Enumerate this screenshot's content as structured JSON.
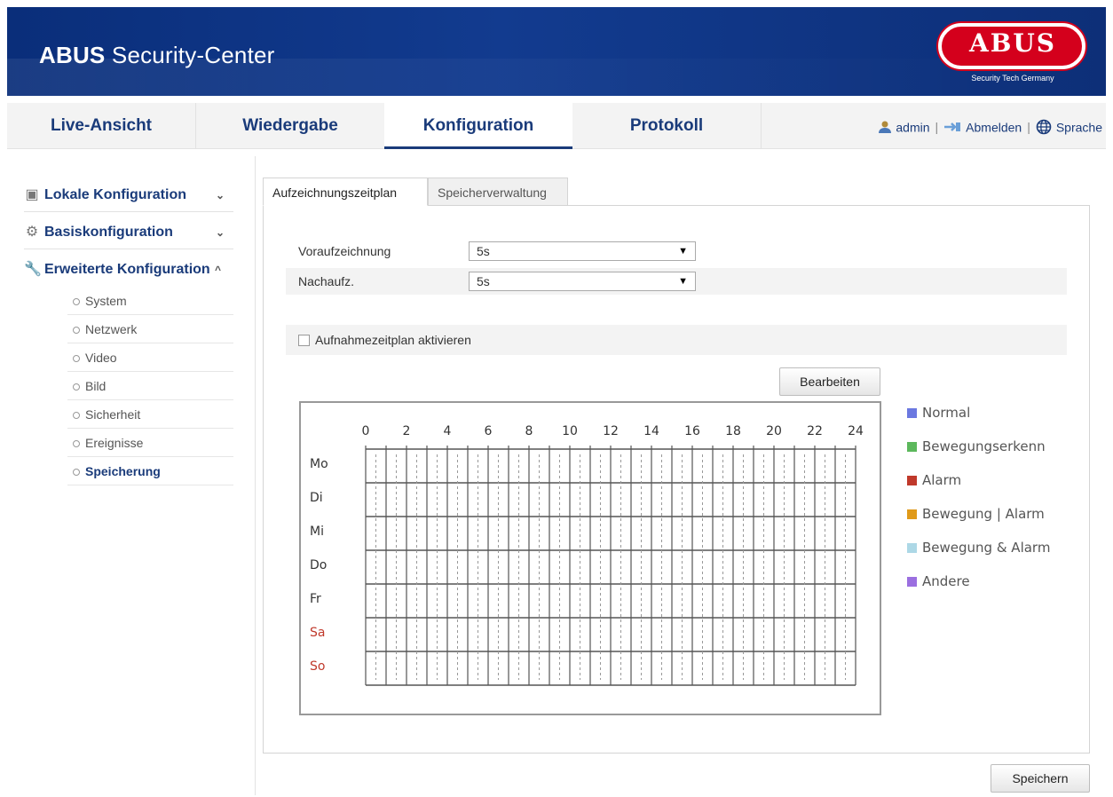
{
  "header": {
    "title_bold": "ABUS",
    "title_rest": " Security-Center",
    "logo_text": "ABUS",
    "logo_sub": "Security Tech Germany"
  },
  "nav": {
    "tabs": [
      {
        "label": "Live-Ansicht"
      },
      {
        "label": "Wiedergabe"
      },
      {
        "label": "Konfiguration",
        "active": true
      },
      {
        "label": "Protokoll"
      }
    ],
    "user": "admin",
    "logout": "Abmelden",
    "language": "Sprache"
  },
  "sidebar": {
    "groups": [
      {
        "label": "Lokale Konfiguration",
        "icon": "monitor-icon",
        "expanded": false
      },
      {
        "label": "Basiskonfiguration",
        "icon": "gear-icon",
        "expanded": false
      },
      {
        "label": "Erweiterte Konfiguration",
        "icon": "wrench-icon",
        "expanded": true
      }
    ],
    "items": [
      {
        "label": "System"
      },
      {
        "label": "Netzwerk"
      },
      {
        "label": "Video"
      },
      {
        "label": "Bild"
      },
      {
        "label": "Sicherheit"
      },
      {
        "label": "Ereignisse"
      },
      {
        "label": "Speicherung",
        "active": true
      }
    ]
  },
  "content": {
    "tabs": [
      {
        "label": "Aufzeichnungszeitplan",
        "active": true
      },
      {
        "label": "Speicherverwaltung"
      }
    ],
    "pre_record": {
      "label": "Voraufzeichnung",
      "value": "5s"
    },
    "post_record": {
      "label": "Nachaufz.",
      "value": "5s"
    },
    "enable_schedule": {
      "label": "Aufnahmezeitplan aktivieren",
      "checked": false
    },
    "edit_button": "Bearbeiten",
    "save_button": "Speichern"
  },
  "schedule": {
    "hours": [
      "0",
      "2",
      "4",
      "6",
      "8",
      "10",
      "12",
      "14",
      "16",
      "18",
      "20",
      "22",
      "24"
    ],
    "days": [
      {
        "label": "Mo",
        "weekend": false
      },
      {
        "label": "Di",
        "weekend": false
      },
      {
        "label": "Mi",
        "weekend": false
      },
      {
        "label": "Do",
        "weekend": false
      },
      {
        "label": "Fr",
        "weekend": false
      },
      {
        "label": "Sa",
        "weekend": true
      },
      {
        "label": "So",
        "weekend": true
      }
    ],
    "weekday_color": "#333333",
    "weekend_color": "#c0392b"
  },
  "legend": [
    {
      "label": "Normal",
      "color": "#6b78e0"
    },
    {
      "label": "Bewegungserkenn",
      "color": "#5cb85c"
    },
    {
      "label": "Alarm",
      "color": "#c0392b"
    },
    {
      "label": "Bewegung | Alarm",
      "color": "#e09a1a"
    },
    {
      "label": "Bewegung & Alarm",
      "color": "#add8e6"
    },
    {
      "label": "Andere",
      "color": "#9b6fe0"
    }
  ]
}
